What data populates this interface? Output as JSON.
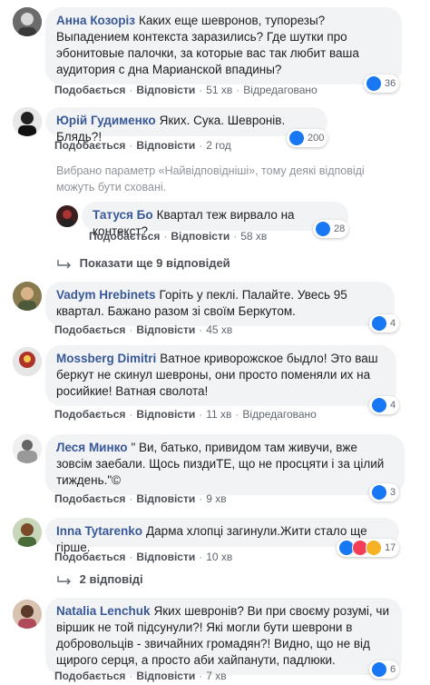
{
  "common": {
    "like": "Подобається",
    "reply": "Відповісти",
    "edited": "Відредаговано"
  },
  "comments": [
    {
      "author": "Анна Козоріз",
      "text": "Каких еще шевронов, тупорезы? Выпадением контекста заразились? Где шутки про эбонитовые палочки, за которые вас так любит ваша аудитория с дна Марианской впадины?",
      "time": "51 хв",
      "reactions": "36"
    },
    {
      "author": "Юрій Гудименко",
      "text": "Яких. Сука. Шевронів. Блядь?!",
      "time": "2 год",
      "reactions": "200"
    },
    {
      "author": "Vadym Hrebinets",
      "text": "Горіть у пеклі. Палайте. Увесь 95 квартал. Бажано разом зі своїм Беркутом.",
      "time": "45 хв",
      "reactions": "4"
    },
    {
      "author": "Mossberg Dimitri",
      "text": "Ватное криворожское быдло! Это ваш беркут не скинул шевроны, они просто поменяли их на росийкие! Ватная сволота!",
      "time": "11 хв",
      "reactions": "4"
    },
    {
      "author": "Леся Минко",
      "text": "\" Ви, батько, привидом там живучи, вже зовсім заебали. Щось пиздиТЕ, що не просцяти і за цілий тиждень.\"©",
      "time": "9 хв",
      "reactions": "3"
    },
    {
      "author": "Inna Tytarenko",
      "text": "Дарма хлопці загинули.Жити стало ще гірше.",
      "time": "10 хв",
      "reactions": "17"
    },
    {
      "author": "Natalia Lenchuk",
      "text": "Яких шевронів? Ви при своєму розумі, чи віршик не той підсунули?! Які могли бути шеврони в добровольців - звичайних громадян?! Видно, що не від щирого серця, а просто аби хайпанути, падлюки.",
      "time": "7 хв",
      "reactions": "6"
    }
  ],
  "notice": "Вибрано параметр «Найвідповідніші», тому деякі відповіді можуть бути сховані.",
  "reply": {
    "author": "Татуся Бо",
    "text": "Квартал теж вирвало на контекст?",
    "time": "58 хв",
    "reactions": "28"
  },
  "show_more": "Показати ще 9 відповідей",
  "replies_count": "2 відповіді",
  "colors": {
    "link": "#385898",
    "bubble": "#f2f3f5",
    "like": "#1877f2",
    "love": "#f33e58",
    "haha": "#f7b125"
  }
}
